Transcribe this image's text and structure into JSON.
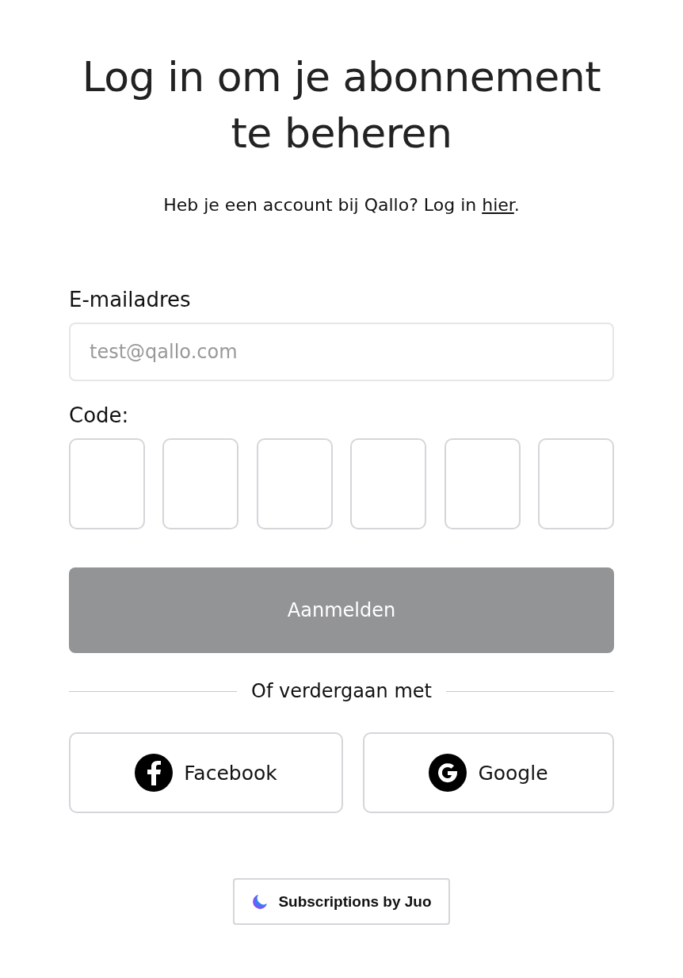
{
  "title": "Log in om je abonnement te beheren",
  "subtitle": {
    "text": "Heb je een account bij Qallo? Log in ",
    "link": "hier",
    "end": "."
  },
  "email": {
    "label": "E-mailadres",
    "placeholder": "test@qallo.com"
  },
  "code": {
    "label": "Code:",
    "boxes": [
      {
        "filled": false
      },
      {
        "filled": false
      },
      {
        "filled": false
      },
      {
        "filled": false
      },
      {
        "filled": false
      },
      {
        "filled": false
      }
    ]
  },
  "submit": {
    "label": "Aanmelden",
    "disabled": true
  },
  "divider": "Of verdergaan met",
  "social": [
    {
      "kind": "facebook",
      "label": "Facebook"
    },
    {
      "kind": "google",
      "label": "Google"
    }
  ],
  "footer_badge": "Subscriptions by Juo"
}
